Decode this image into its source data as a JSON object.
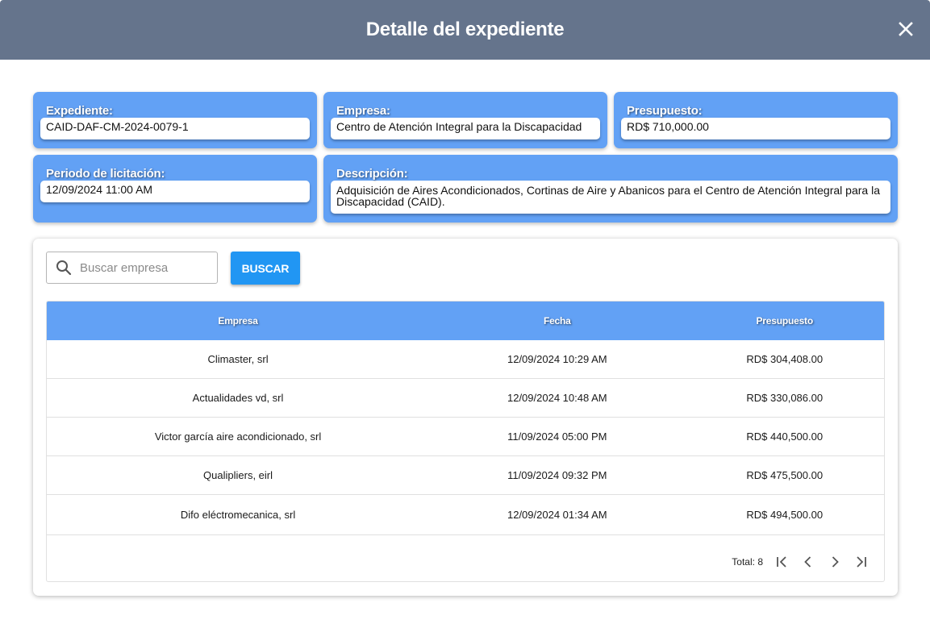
{
  "dialog": {
    "title": "Detalle del expediente",
    "close_icon": "close-icon"
  },
  "fields": {
    "expediente": {
      "label": "Expediente:",
      "value": "CAID-DAF-CM-2024-0079-1"
    },
    "empresa": {
      "label": "Empresa:",
      "value": "Centro de Atención Integral para la Discapacidad"
    },
    "presupuesto": {
      "label": "Presupuesto:",
      "value": "RD$ 710,000.00"
    },
    "periodo": {
      "label": "Periodo de licitación:",
      "value": "12/09/2024 11:00 AM"
    },
    "descripcion": {
      "label": "Descripción:",
      "value": "Adquisición de Aires Acondicionados, Cortinas de Aire y Abanicos para el Centro de Atención Integral para la Discapacidad (CAID)."
    }
  },
  "search": {
    "placeholder": "Buscar empresa",
    "value": "",
    "icon": "search-icon",
    "button_label": "BUSCAR"
  },
  "table": {
    "columns": [
      "Empresa",
      "Fecha",
      "Presupuesto"
    ],
    "rows": [
      [
        "Climaster, srl",
        "12/09/2024 10:29 AM",
        "RD$ 304,408.00"
      ],
      [
        "Actualidades vd, srl",
        "12/09/2024 10:48 AM",
        "RD$ 330,086.00"
      ],
      [
        "Victor garcía aire acondicionado, srl",
        "11/09/2024 05:00 PM",
        "RD$ 440,500.00"
      ],
      [
        "Qualipliers, eirl",
        "11/09/2024 09:32 PM",
        "RD$ 475,500.00"
      ],
      [
        "Difo eléctromecanica, srl",
        "12/09/2024 01:34 AM",
        "RD$ 494,500.00"
      ]
    ]
  },
  "pagination": {
    "total_text": "Total: 8",
    "icons": [
      "first-page-icon",
      "previous-page-icon",
      "next-page-icon",
      "last-page-icon"
    ]
  },
  "colors": {
    "header_bg": "#65748c",
    "card_bg": "#62a1f5",
    "button_bg": "#2196f3"
  }
}
